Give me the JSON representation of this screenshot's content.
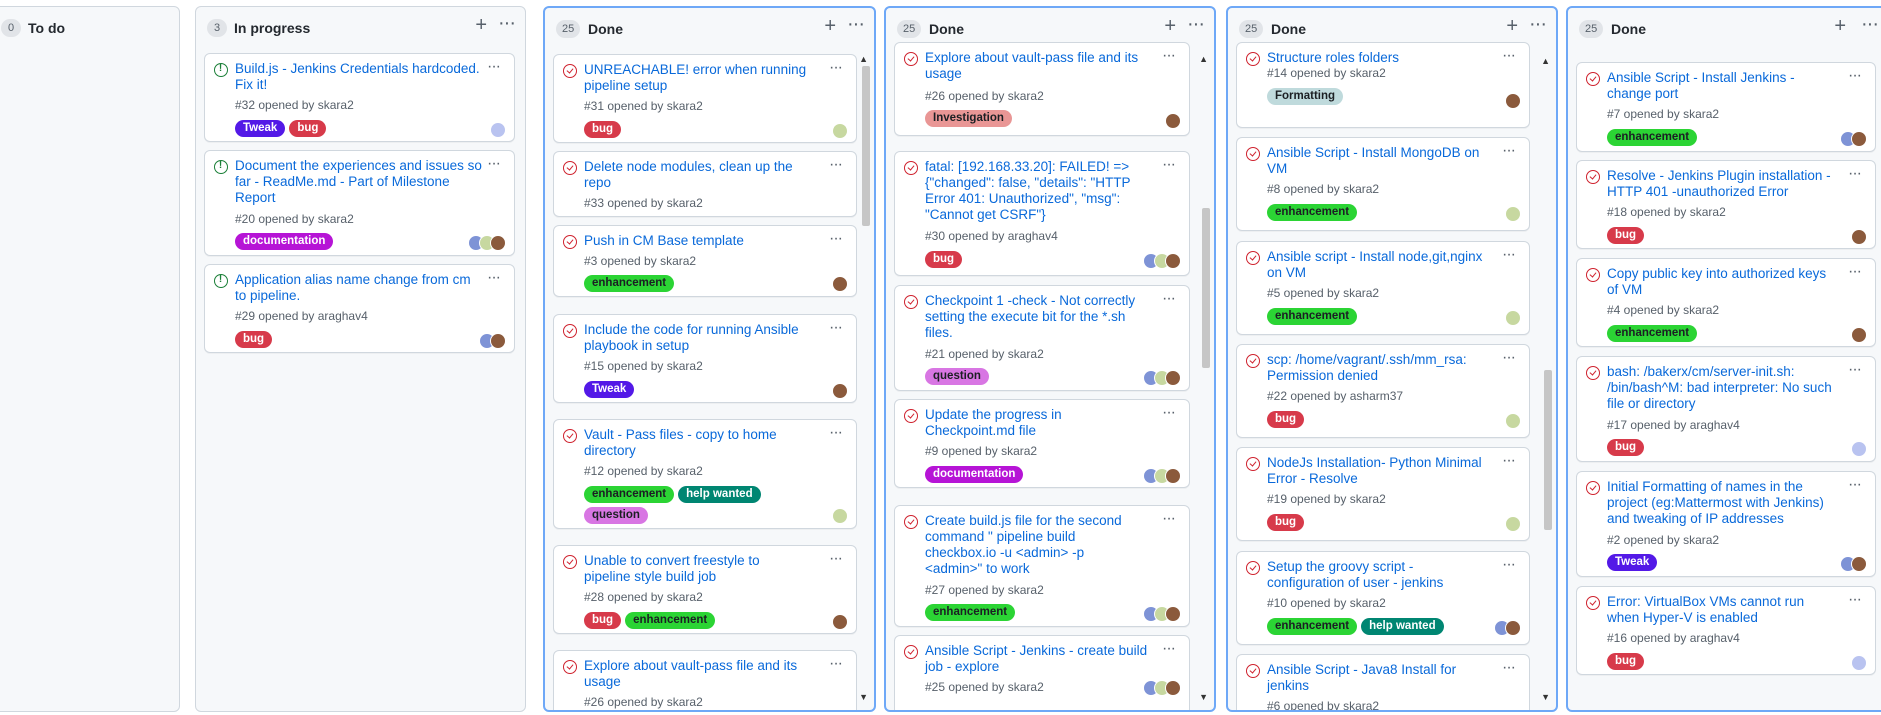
{
  "columns": [
    {
      "count": "0",
      "title": "To do",
      "cards": []
    },
    {
      "count": "3",
      "title": "In progress",
      "cards": [
        {
          "title": "Build.js - Jenkins Credentials hardcoded. Fix it!",
          "meta": "#32 opened by skara2",
          "labels": [
            "Tweak",
            "bug"
          ],
          "state": "open"
        },
        {
          "title": "Document the experiences and issues so far - ReadMe.md - Part of Milestone Report",
          "meta": "#20 opened by skara2",
          "labels": [
            "documentation"
          ],
          "state": "open"
        },
        {
          "title": "Application alias name change from cm to pipeline.",
          "meta": "#29 opened by araghav4",
          "labels": [
            "bug"
          ],
          "state": "open"
        }
      ]
    },
    {
      "count": "25",
      "title": "Done",
      "cards": [
        {
          "title": "UNREACHABLE! error when running pipeline setup",
          "meta": "#31 opened by skara2",
          "labels": [
            "bug"
          ]
        },
        {
          "title": "Delete node modules, clean up the repo",
          "meta": "#33 opened by skara2",
          "labels": []
        },
        {
          "title": "Push in CM Base template",
          "meta": "#3 opened by skara2",
          "labels": [
            "enhancement"
          ]
        },
        {
          "title": "Include the code for running Ansible playbook in setup",
          "meta": "#15 opened by skara2",
          "labels": [
            "Tweak"
          ]
        },
        {
          "title": "Vault - Pass files - copy to home directory",
          "meta": "#12 opened by skara2",
          "labels": [
            "enhancement",
            "help wanted",
            "question"
          ]
        },
        {
          "title": "Unable to convert freestyle to pipeline style build job",
          "meta": "#28 opened by skara2",
          "labels": [
            "bug",
            "enhancement"
          ]
        },
        {
          "title": "Explore about vault-pass file and its usage",
          "meta": "#26 opened by skara2",
          "labels": []
        }
      ]
    },
    {
      "count": "25",
      "title": "Done",
      "cards": [
        {
          "title": "Explore about vault-pass file and its usage",
          "meta": "#26 opened by skara2",
          "labels": [
            "Investigation"
          ]
        },
        {
          "title": "fatal: [192.168.33.20]: FAILED! => {\"changed\": false, \"details\": \"HTTP Error 401: Unauthorized\", \"msg\": \"Cannot get CSRF\"}",
          "meta": "#30 opened by araghav4",
          "labels": [
            "bug"
          ]
        },
        {
          "title": "Checkpoint 1 -check - Not correctly setting the execute bit for the *.sh files.",
          "meta": "#21 opened by skara2",
          "labels": [
            "question"
          ]
        },
        {
          "title": "Update the progress in Checkpoint.md file",
          "meta": "#9 opened by skara2",
          "labels": [
            "documentation"
          ]
        },
        {
          "title": "Create build.js file for the second command \" pipeline build checkbox.io -u <admin> -p <admin>\" to work",
          "meta": "#27 opened by skara2",
          "labels": [
            "enhancement"
          ]
        },
        {
          "title": "Ansible Script - Jenkins - create build job - explore",
          "meta": "#25 opened by skara2",
          "labels": []
        }
      ]
    },
    {
      "count": "25",
      "title": "Done",
      "cards": [
        {
          "title": "Structure roles folders",
          "meta": "#14 opened by skara2",
          "labels": [
            "Formatting"
          ]
        },
        {
          "title": "Ansible Script - Install MongoDB on VM",
          "meta": "#8 opened by skara2",
          "labels": [
            "enhancement"
          ]
        },
        {
          "title": "Ansible script - Install node,git,nginx on VM",
          "meta": "#5 opened by skara2",
          "labels": [
            "enhancement"
          ]
        },
        {
          "title": "scp: /home/vagrant/.ssh/mm_rsa: Permission denied",
          "meta": "#22 opened by asharm37",
          "labels": [
            "bug"
          ]
        },
        {
          "title": "NodeJs Installation- Python Minimal Error - Resolve",
          "meta": "#19 opened by skara2",
          "labels": [
            "bug"
          ]
        },
        {
          "title": "Setup the groovy script - configuration of user - jenkins",
          "meta": "#10 opened by skara2",
          "labels": [
            "enhancement",
            "help wanted"
          ]
        },
        {
          "title": "Ansible Script - Java8 Install for jenkins",
          "meta": "#6 opened by skara2",
          "labels": []
        }
      ]
    },
    {
      "count": "25",
      "title": "Done",
      "cards": [
        {
          "title": "Ansible Script - Install Jenkins - change port",
          "meta": "#7 opened by skara2",
          "labels": [
            "enhancement"
          ]
        },
        {
          "title": "Resolve - Jenkins Plugin installation - HTTP 401 -unauthorized Error",
          "meta": "#18 opened by skara2",
          "labels": [
            "bug"
          ]
        },
        {
          "title": "Copy public key into authorized keys of VM",
          "meta": "#4 opened by skara2",
          "labels": [
            "enhancement"
          ]
        },
        {
          "title": "bash: /bakerx/cm/server-init.sh: /bin/bash^M: bad interpreter: No such file or directory",
          "meta": "#17 opened by araghav4",
          "labels": [
            "bug"
          ]
        },
        {
          "title": "Initial Formatting of names in the project (eg:Mattermost with Jenkins) and tweaking of IP addresses",
          "meta": "#2 opened by skara2",
          "labels": [
            "Tweak"
          ]
        },
        {
          "title": "Error: VirtualBox VMs cannot run when Hyper-V is enabled",
          "meta": "#16 opened by araghav4",
          "labels": [
            "bug"
          ]
        }
      ]
    }
  ],
  "label_styles": {
    "bug": "#d73a4a",
    "enhancement": "#2bd434",
    "Tweak": "#5319e7",
    "documentation": "#b614d6",
    "help wanted": "#008672",
    "question": "#d876e3",
    "Investigation": "#e99695",
    "Formatting": "#bfdadc"
  }
}
